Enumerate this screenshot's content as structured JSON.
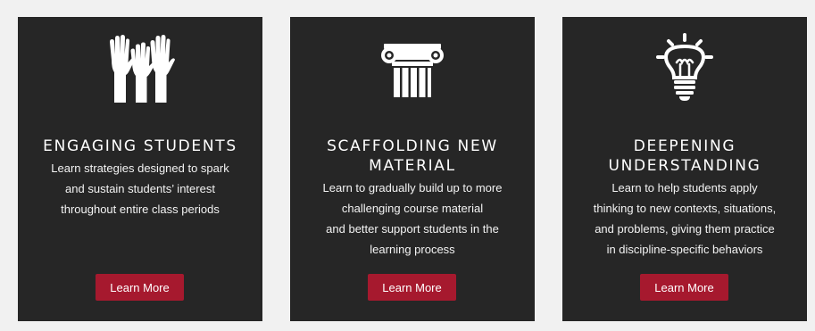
{
  "cards": [
    {
      "icon": "raised-hands-icon",
      "title_lines": [
        "ENGAGING STUDENTS"
      ],
      "description_lines": [
        "Learn strategies designed to spark",
        "and sustain students’ interest",
        "throughout entire class periods"
      ],
      "button_label": "Learn More"
    },
    {
      "icon": "column-pillar-icon",
      "title_lines": [
        "SCAFFOLDING NEW",
        "MATERIAL"
      ],
      "description_lines": [
        "Learn to gradually build up to more",
        "challenging course material",
        "and better support students in the",
        "learning process"
      ],
      "button_label": "Learn More"
    },
    {
      "icon": "lightbulb-icon",
      "title_lines": [
        "DEEPENING",
        "UNDERSTANDING"
      ],
      "description_lines": [
        "Learn to help students apply",
        "thinking to new contexts, situations,",
        "and problems, giving them practice",
        "in discipline-specific behaviors"
      ],
      "button_label": "Learn More"
    }
  ],
  "colors": {
    "card_background": "#262626",
    "page_background": "#f1f1f1",
    "button_background": "#a6192e",
    "text": "#ffffff"
  }
}
